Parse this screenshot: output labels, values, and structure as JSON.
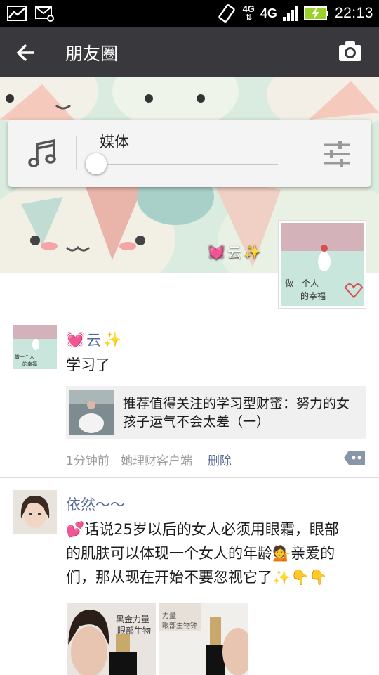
{
  "status_bar": {
    "network_a": "4G",
    "network_b": "4G",
    "time": "22:13"
  },
  "action_bar": {
    "title": "朋友圈"
  },
  "volume_panel": {
    "stream_label": "媒体",
    "level": 0
  },
  "cover": {
    "owner_name": "云"
  },
  "posts": [
    {
      "author": "云",
      "text": "学习了",
      "link_title": "推荐值得关注的学习型财蜜：努力的女孩子运气不会太差（一）",
      "time": "1分钟前",
      "source": "她理财客户端",
      "delete_label": "删除"
    },
    {
      "author": "依然～～",
      "text_line1": "话说25岁以后的女人必须用眼霜，眼部",
      "text_line2": "的肌肤可以体现一个女人的年龄",
      "text_line2b": "亲爱的",
      "text_line3": "们，那从现在开始不要忽视它了",
      "photo1_text": "黑金力量 眼部生物",
      "photo2_text": "力量 眼部生物钟"
    }
  ],
  "avatar_text": "做一个人的幸福",
  "colors": {
    "link_blue": "#576b95",
    "actionbar": "#39393d",
    "battery": "#9bd22a"
  }
}
